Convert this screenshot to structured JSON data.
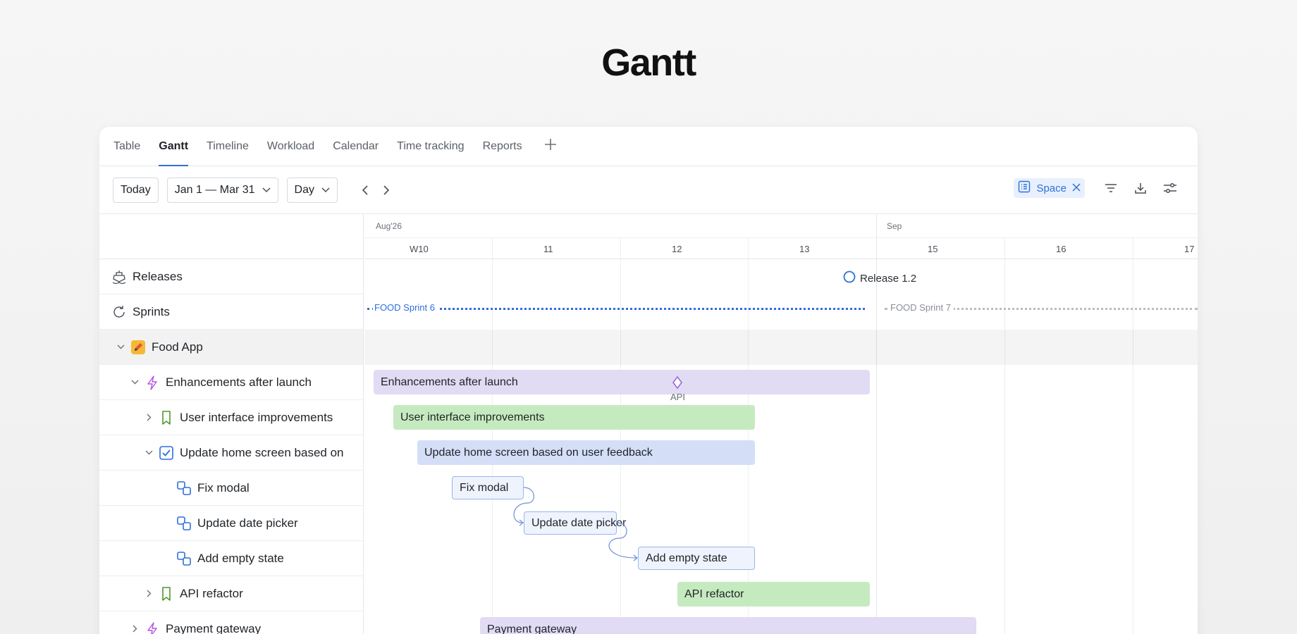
{
  "title": "Gantt",
  "tabs": [
    {
      "label": "Table",
      "active": false
    },
    {
      "label": "Gantt",
      "active": true
    },
    {
      "label": "Timeline",
      "active": false
    },
    {
      "label": "Workload",
      "active": false
    },
    {
      "label": "Calendar",
      "active": false
    },
    {
      "label": "Time tracking",
      "active": false
    },
    {
      "label": "Reports",
      "active": false
    }
  ],
  "toolbar": {
    "today_label": "Today",
    "date_range": "Jan 1 — Mar 31",
    "scale": "Day",
    "filter_chip": "Space"
  },
  "timeline": {
    "months": [
      {
        "label": "Aug'26"
      },
      {
        "label": "Sep"
      }
    ],
    "weeks": [
      "W10",
      "11",
      "12",
      "13",
      "15",
      "16",
      "17"
    ]
  },
  "rows": [
    {
      "label": "Releases",
      "icon": "ship-icon"
    },
    {
      "label": "Sprints",
      "icon": "refresh-icon"
    },
    {
      "label": "Food App",
      "icon": "pencil-icon"
    },
    {
      "label": "Enhancements after launch",
      "icon": "lightning-icon"
    },
    {
      "label": "User interface improvements",
      "icon": "bookmark-icon"
    },
    {
      "label": "Update home screen based on",
      "icon": "checkbox-icon"
    },
    {
      "label": "Fix modal",
      "icon": "subtask-icon"
    },
    {
      "label": "Update date picker",
      "icon": "subtask-icon"
    },
    {
      "label": "Add empty state",
      "icon": "subtask-icon"
    },
    {
      "label": "API refactor",
      "icon": "bookmark-icon"
    },
    {
      "label": "Payment gateway",
      "icon": "lightning-icon"
    }
  ],
  "gantt": {
    "release": "Release 1.2",
    "sprint_active": "FOOD Sprint 6",
    "sprint_next": "FOOD Sprint 7",
    "milestone": "API",
    "bars": [
      "Enhancements after launch",
      "User interface improvements",
      "Update home screen based on user feedback",
      "Fix modal",
      "Update date picker",
      "Add empty state",
      "API refactor",
      "Payment gateway"
    ]
  },
  "colors": {
    "accent": "#2f6fdb",
    "epic_bar": "#e2dbf4",
    "story_bar": "#c6eac0",
    "task_bar": "#d4def7",
    "subtask_bar": "#eef3fd"
  }
}
